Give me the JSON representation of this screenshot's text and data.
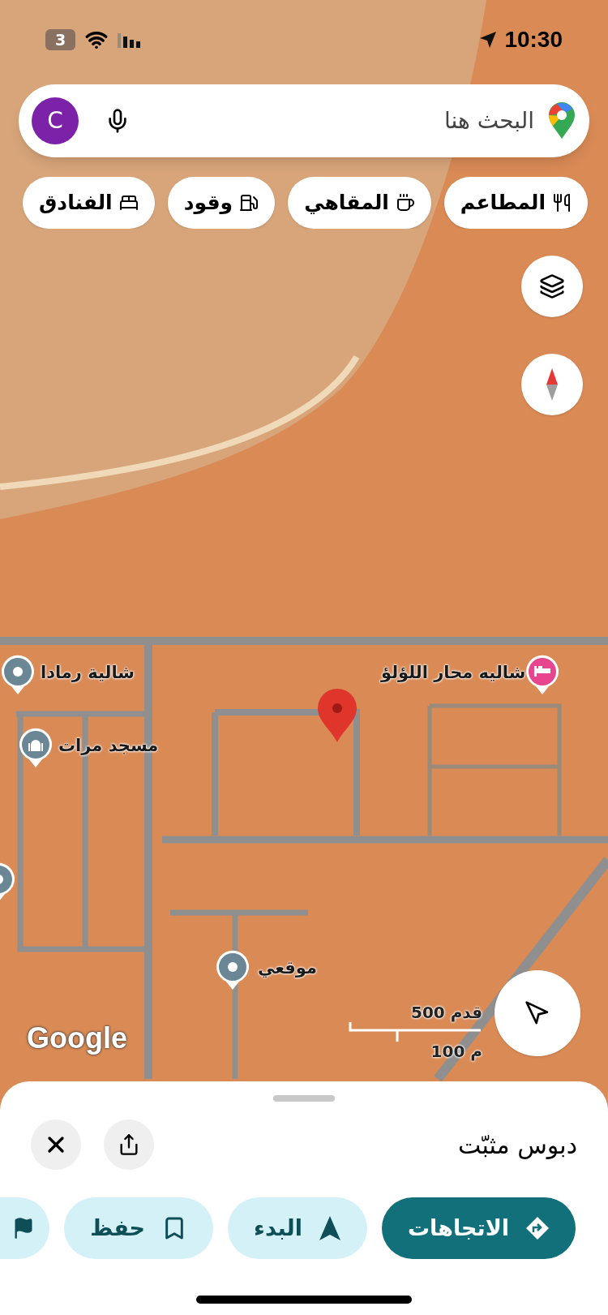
{
  "status_bar": {
    "time": "10:30",
    "badge": "3"
  },
  "search": {
    "placeholder": "البحث هنا",
    "avatar": "C"
  },
  "chips": [
    {
      "label": "المطاعم",
      "kind": "restaurant"
    },
    {
      "label": "المقاهي",
      "kind": "cafe"
    },
    {
      "label": "وقود",
      "kind": "fuel"
    },
    {
      "label": "الفنادق",
      "kind": "hotel"
    }
  ],
  "map": {
    "places": [
      {
        "name": "شالية رمادا",
        "kind": "place"
      },
      {
        "name": "مسجد مرات",
        "kind": "mosque"
      },
      {
        "name": "شاليه محار اللؤلؤ",
        "kind": "hotel"
      },
      {
        "name": "موقعي",
        "kind": "place"
      }
    ],
    "logo": "Google",
    "scale": {
      "feet": "500 قدم",
      "meters": "100 م"
    }
  },
  "sheet": {
    "title": "دبوس مثبّت",
    "actions": [
      {
        "label": "الاتجاهات",
        "kind": "directions",
        "primary": true
      },
      {
        "label": "البدء",
        "kind": "start",
        "primary": false
      },
      {
        "label": "حفظ",
        "kind": "save",
        "primary": false
      },
      {
        "kind": "flag",
        "primary": false
      }
    ]
  }
}
